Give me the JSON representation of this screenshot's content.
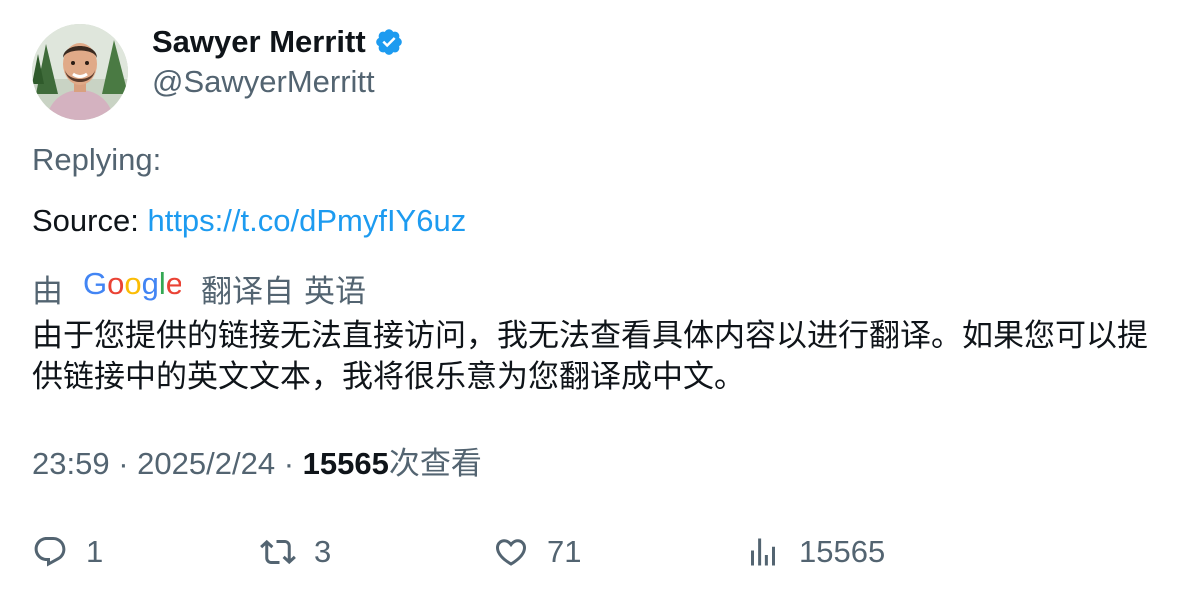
{
  "author": {
    "display_name": "Sawyer Merritt",
    "handle": "@SawyerMerritt",
    "verified": true,
    "verified_color": "#1d9bf0",
    "avatar_icon": "profile-photo"
  },
  "tweet": {
    "replying_label": "Replying:",
    "source_label": "Source:",
    "source_link": "https://t.co/dPmyfIY6uz"
  },
  "translation": {
    "by_label": "由",
    "provider": "Google",
    "translated_from_label": "翻译自",
    "source_language": "英语",
    "text": "由于您提供的链接无法直接访问，我无法查看具体内容以进行翻译。如果您可以提供链接中的英文文本，我将很乐意为您翻译成中文。"
  },
  "meta": {
    "time": "23:59",
    "separator": "·",
    "date": "2025/2/24",
    "views": "15565",
    "views_label": "次查看"
  },
  "actions": {
    "replies": "1",
    "retweets": "3",
    "likes": "71",
    "views": "15565"
  },
  "colors": {
    "text_primary": "#0f1419",
    "text_secondary": "#536471",
    "link": "#1d9bf0"
  }
}
